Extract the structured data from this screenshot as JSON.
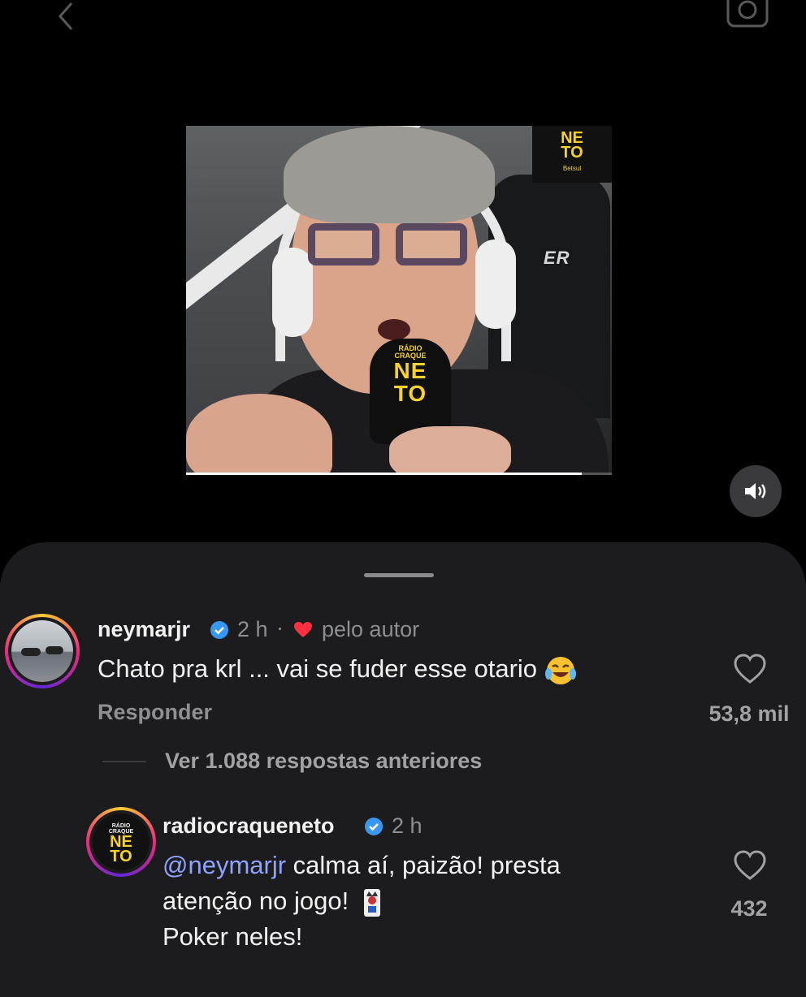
{
  "video": {
    "logo_line1": "NE",
    "logo_line2": "TO",
    "logo_sub": "Betsul",
    "mic_line1": "RÁDIO",
    "mic_line2": "CRAQUE",
    "mic_line3": "NE",
    "mic_line4": "TO",
    "chair_brand": "ER",
    "progress": 0.93
  },
  "comments": [
    {
      "username": "neymarjr",
      "verified": true,
      "time": "2 h",
      "separator": "·",
      "liked_by_author": "pelo autor",
      "text": "Chato pra krl ... vai se fuder esse otario",
      "emoji": "laughing-tears",
      "reply_label": "Responder",
      "likes": "53,8 mil"
    },
    {
      "username": "radiocraqueneto",
      "verified": true,
      "time": "2 h",
      "mention": "@neymarjr",
      "text_line1_rest": " calma aí, paizão! presta",
      "text_line2": "atenção no jogo!",
      "emoji": "joker-card",
      "text_line3": "Poker neles!",
      "likes": "432",
      "avatar_line1": "RÁDIO",
      "avatar_line2": "CRAQUE",
      "avatar_line3": "NE",
      "avatar_line4": "TO"
    }
  ],
  "view_replies_label": "Ver 1.088 respostas anteriores",
  "colors": {
    "sheet": "#1c1c1e",
    "verified": "#3897f0",
    "heart_red": "#ff3040",
    "mention": "#8fa3ff",
    "brand_yellow": "#f6d12f"
  }
}
